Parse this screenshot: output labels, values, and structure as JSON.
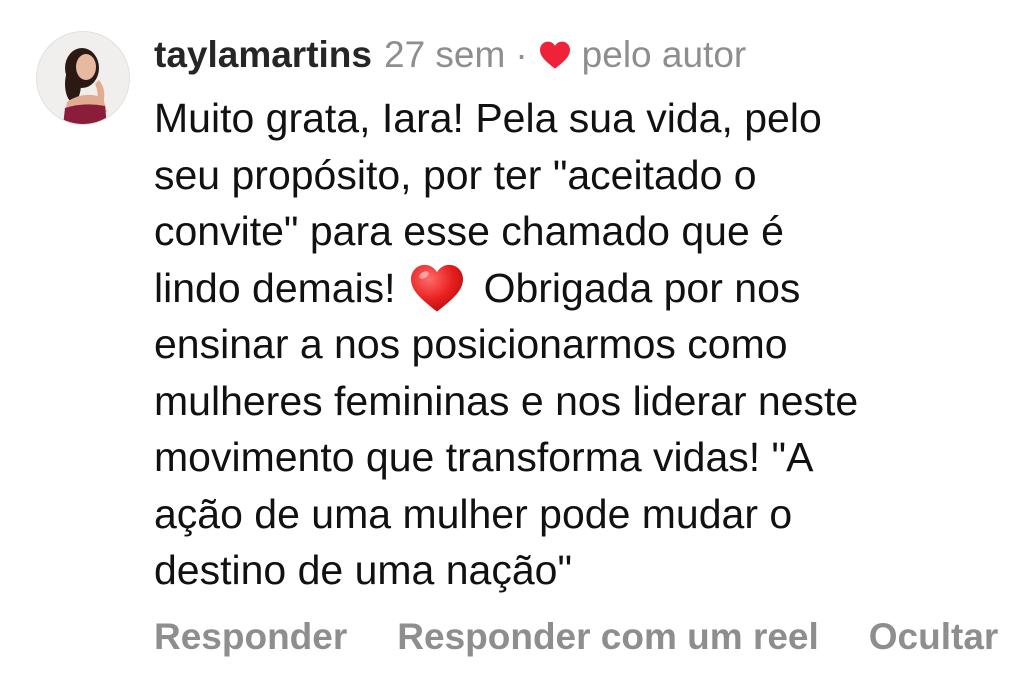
{
  "comment": {
    "username": "taylamartins",
    "time_ago": "27 sem",
    "separator": "·",
    "liked_by_author": "pelo autor",
    "body_lines": [
      "Muito grata, Iara! Pela sua vida, pelo",
      "seu propósito, por ter \"aceitado o",
      "convite\" para esse chamado que é",
      "lindo demais!",
      "Obrigada por nos",
      "ensinar a nos posicionarmos como",
      "mulheres femininas e nos liderar neste",
      "movimento que transforma vidas! \"A",
      "ação de uma mulher pode mudar o",
      "destino de uma nação\""
    ],
    "inline_emoji": "heart-emoji"
  },
  "actions": {
    "reply": "Responder",
    "reply_with_reel": "Responder com um reel",
    "hide": "Ocultar"
  },
  "colors": {
    "heart": "#f0223a",
    "secondary_text": "#8e8e8e",
    "primary_text": "#111111",
    "username": "#262626"
  },
  "icons": {
    "liked": "heart-icon"
  }
}
